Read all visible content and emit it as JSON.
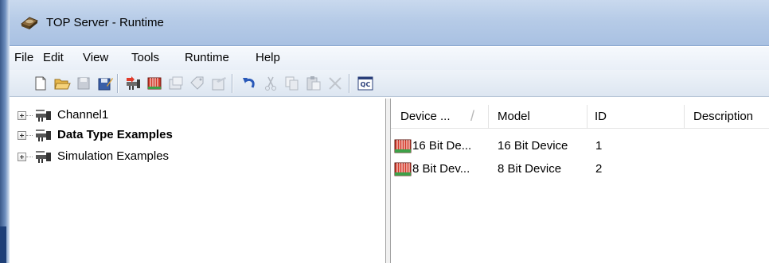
{
  "window": {
    "title": "TOP Server - Runtime"
  },
  "menu": [
    "File",
    "Edit",
    "View",
    "Tools",
    "Runtime",
    "Help"
  ],
  "toolbar": {
    "buttons": [
      "new-file-icon",
      "open-folder-icon",
      "save-icon",
      "save-as-icon",
      "new-channel-icon",
      "new-device-icon",
      "new-tag-group-icon",
      "new-tag-icon",
      "properties-icon",
      "undo-icon",
      "cut-icon",
      "copy-icon",
      "paste-icon",
      "delete-icon",
      "quick-client-icon"
    ],
    "quick_client_label": "QC"
  },
  "tree": {
    "items": [
      {
        "label": "Channel1",
        "bold": false
      },
      {
        "label": "Data Type Examples",
        "bold": true
      },
      {
        "label": "Simulation Examples",
        "bold": false
      }
    ]
  },
  "list": {
    "columns": [
      "Device ...",
      "Model",
      "ID",
      "Description"
    ],
    "sort_indicator": "/",
    "rows": [
      {
        "name": "16 Bit De...",
        "model": "16 Bit Device",
        "id": "1"
      },
      {
        "name": "8 Bit Dev...",
        "model": "8 Bit Device",
        "id": "2"
      }
    ]
  }
}
